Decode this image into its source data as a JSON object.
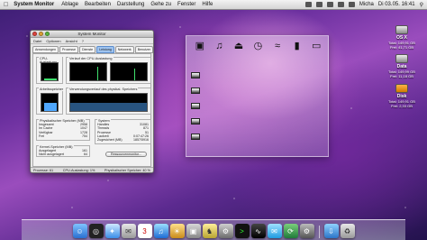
{
  "menubar": {
    "apple": "",
    "app": "System Monitor",
    "items": [
      "Ablage",
      "Bearbeiten",
      "Darstellung",
      "Gehe zu",
      "Fenster",
      "Hilfe"
    ],
    "user": "Micha",
    "clock": "Di 03.05. 16:41"
  },
  "window": {
    "title": "System Monitor",
    "menu": [
      "Datei",
      "Optionen",
      "Ansicht",
      "?"
    ],
    "tabs": [
      "Anwendungen",
      "Prozesse",
      "Dienste",
      "Leistung",
      "Netzwerk",
      "Benutzer"
    ],
    "active_tab": "Leistung",
    "cpu_label": "CPU-Auslastung",
    "cpu_history_label": "Verlauf der CPU-Auslastung",
    "mem_label": "Arbeitsspeicher",
    "mem_history_label": "Verwendungsverlauf des physikal. Speichers",
    "phys_title": "Physikalischer Speicher (MB)",
    "phys": [
      {
        "k": "Insgesamt",
        "v": "2958"
      },
      {
        "k": "Im Cache",
        "v": "1047"
      },
      {
        "k": "Verfügbar",
        "v": "1728"
      },
      {
        "k": "Frei",
        "v": "754"
      }
    ],
    "kernel_title": "Kernel-Speicher (MB)",
    "kernel": [
      {
        "k": "Ausgelagert",
        "v": "161"
      },
      {
        "k": "Nicht ausgelagert",
        "v": "64"
      }
    ],
    "system_title": "System",
    "system": [
      {
        "k": "Handles",
        "v": "31081"
      },
      {
        "k": "Threads",
        "v": "871"
      },
      {
        "k": "Prozesse",
        "v": "51"
      },
      {
        "k": "Laufzeit",
        "v": "0:07:47:26"
      },
      {
        "k": "Zugesichert (MB)",
        "v": "1857/5916"
      }
    ],
    "resource_button": "Ressourcenmonitor...",
    "status_processes": "Prozesse: 61",
    "status_cpu": "CPU-Auslastung: 1%",
    "status_memory": "Physikalischer Speicher: 40 %"
  },
  "panel": {
    "icons": [
      "window-icon",
      "music-icon",
      "eject-icon",
      "clock-icon",
      "wifi-icon",
      "battery-icon",
      "scale-icon"
    ]
  },
  "desktop": [
    {
      "name": "OS X",
      "line1": "Total: 149,91 GB",
      "line2": "Frei: 41,71 GB"
    },
    {
      "name": "Data",
      "line1": "Total: 149,99 GB",
      "line2": "Frei: 11,18 GB"
    },
    {
      "name": "Disk",
      "line1": "Total: 149,91 GB",
      "line2": "Frei: 2,33 GB"
    }
  ],
  "dock": {
    "items": [
      "finder-icon",
      "dashboard-icon",
      "safari-icon",
      "mail-icon",
      "calendar-icon",
      "itunes-icon",
      "photo-icon",
      "preview-icon",
      "chess-icon",
      "system-preferences-icon",
      "terminal-icon",
      "activity-icon",
      "messenger-icon",
      "time-machine-icon",
      "gear-icon",
      "downloads-icon",
      "trash-icon"
    ]
  }
}
